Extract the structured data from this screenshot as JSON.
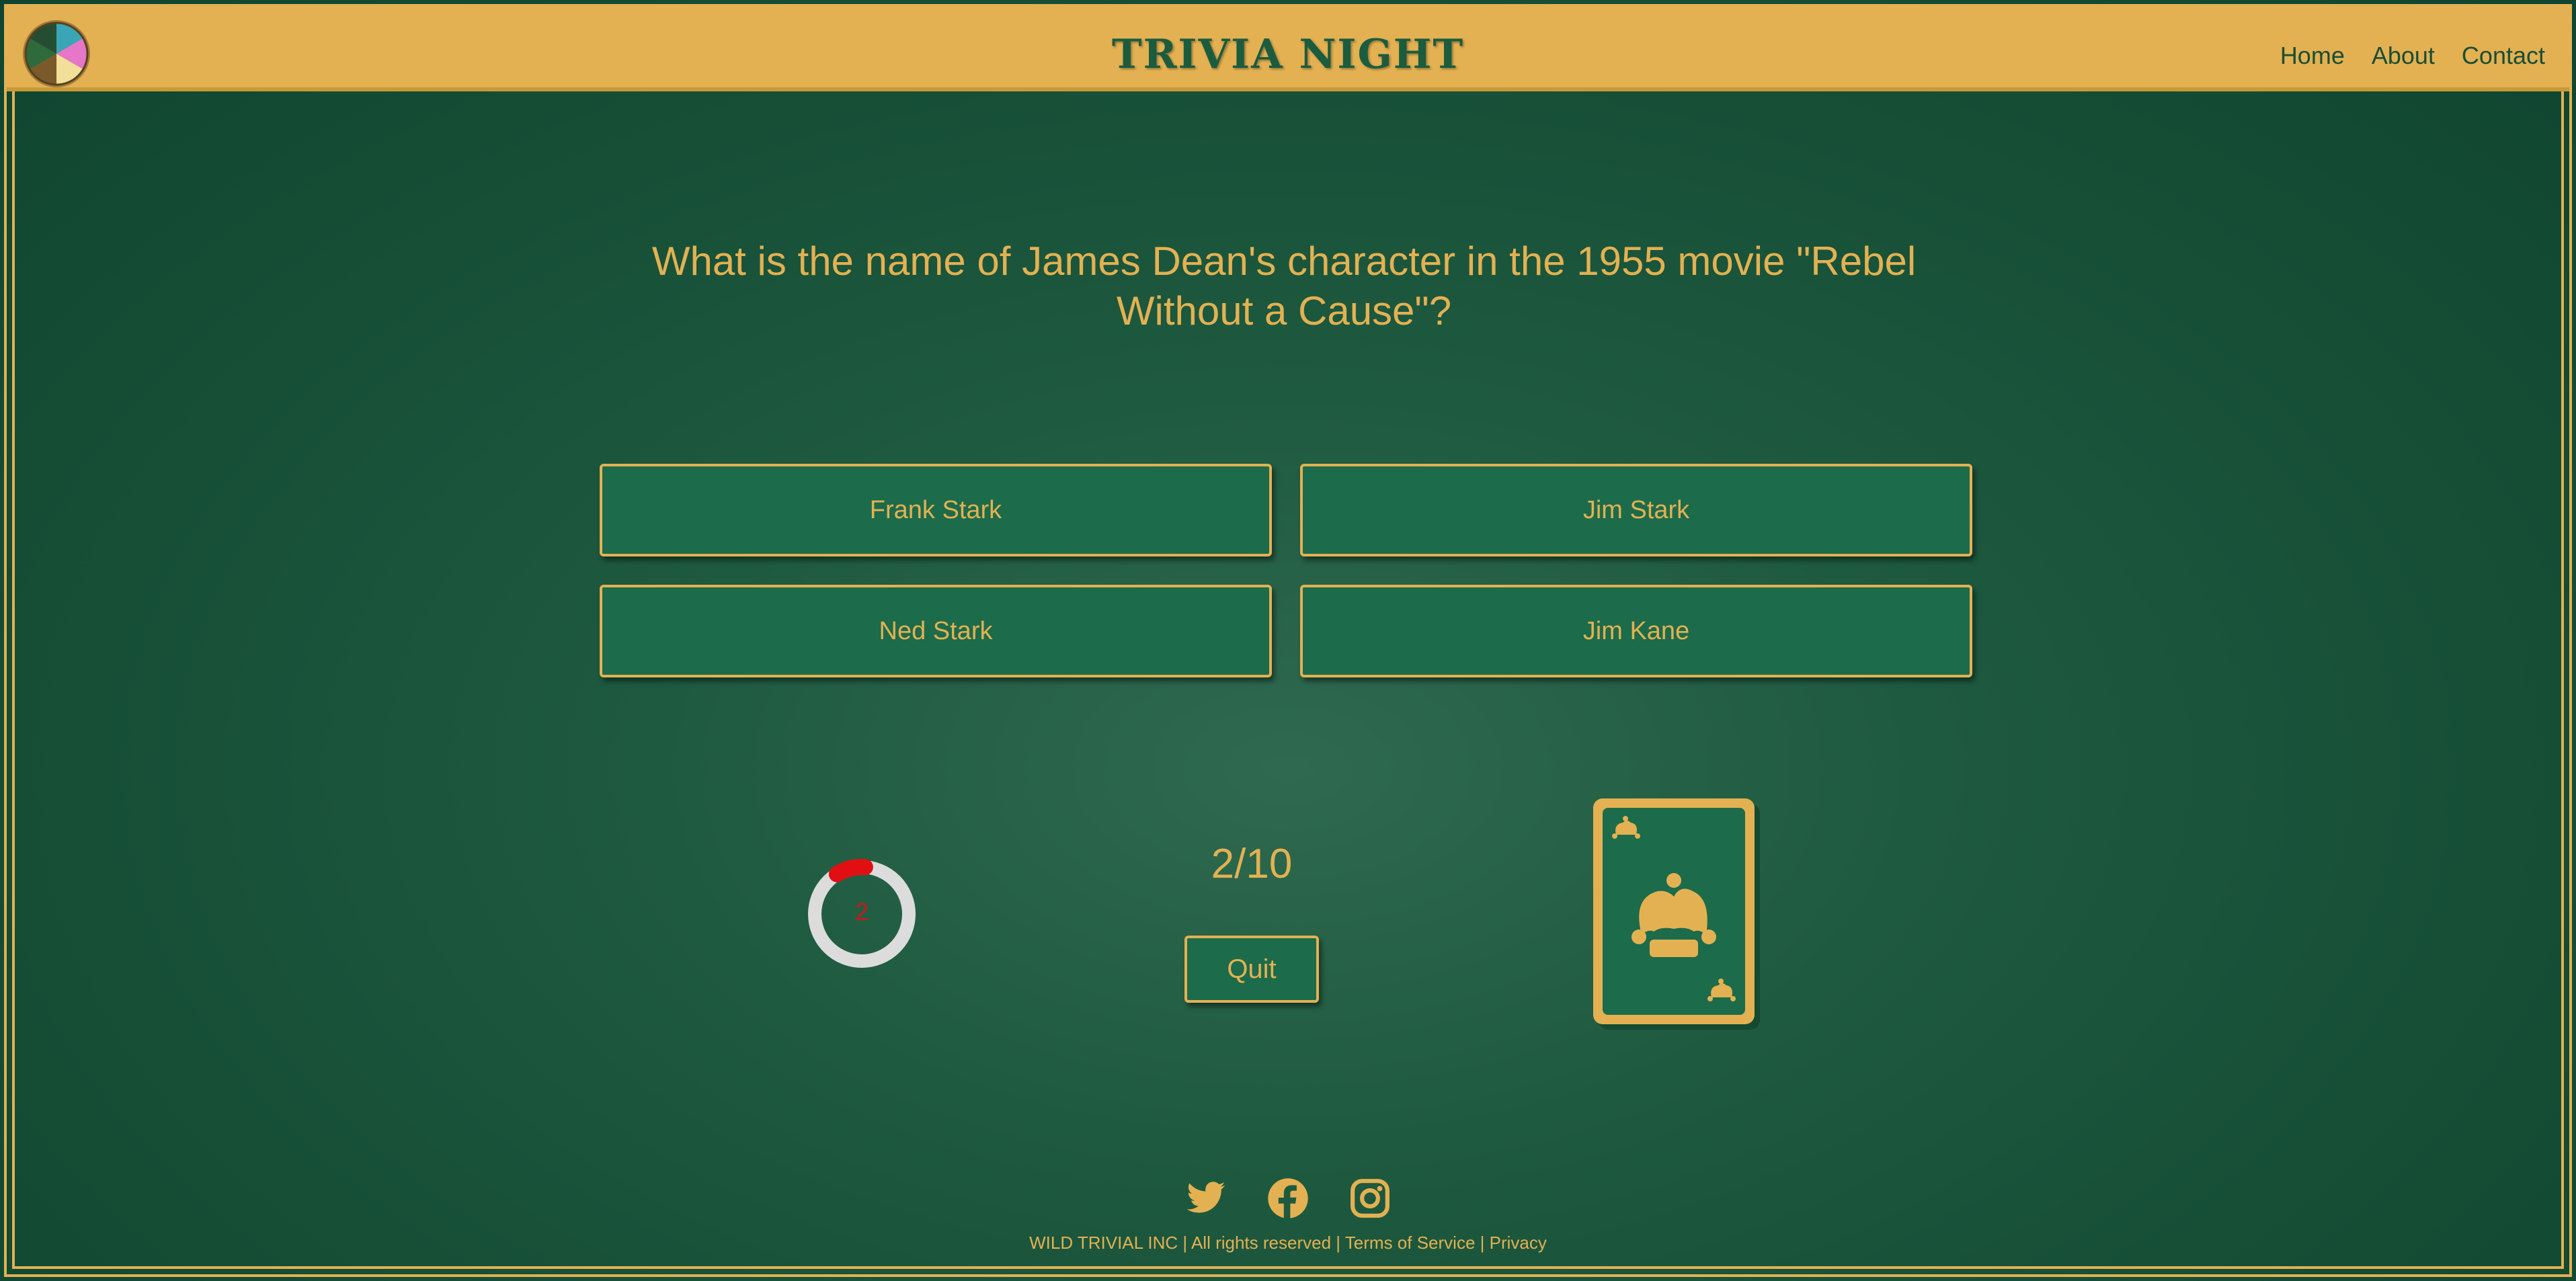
{
  "header": {
    "brand": "TRIVIA NIGHT",
    "nav": [
      "Home",
      "About",
      "Contact"
    ]
  },
  "quiz": {
    "question": "What is the name of James Dean's character in the 1955 movie \"Rebel Without a Cause\"?",
    "answers": [
      "Frank Stark",
      "Jim Stark",
      "Ned Stark",
      "Jim Kane"
    ],
    "timer_seconds": "2",
    "timer_fraction_remaining": 0.1,
    "progress": "2/10",
    "quit_label": "Quit"
  },
  "footer": {
    "company": "WILD TRIVIAL INC",
    "separator": "|",
    "rights": "All rights reserved",
    "terms": "Terms of Service",
    "privacy": "Privacy"
  },
  "social": [
    "twitter-icon",
    "facebook-icon",
    "instagram-icon"
  ],
  "colors": {
    "gold": "#e3b152",
    "green": "#1c6b4b",
    "timer_red": "#e10f12",
    "timer_track": "#dcdcdc"
  }
}
